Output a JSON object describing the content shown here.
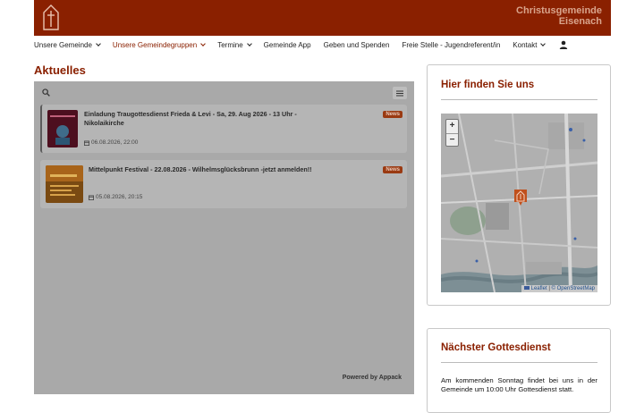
{
  "header": {
    "org_line1": "Christusgemeinde",
    "org_line2": "Eisenach",
    "colors": {
      "brand": "#8a2000",
      "brand_text": "#d9a48c"
    }
  },
  "nav": {
    "items": [
      {
        "label": "Unsere Gemeinde",
        "dropdown": true
      },
      {
        "label": "Unsere Gemeindegruppen",
        "dropdown": true,
        "active": true
      },
      {
        "label": "Termine",
        "dropdown": true
      },
      {
        "label": "Gemeinde App"
      },
      {
        "label": "Geben und Spenden"
      },
      {
        "label": "Freie Stelle - Jugendreferent/in"
      },
      {
        "label": "Kontakt",
        "dropdown": true
      }
    ],
    "user_icon": "user-icon"
  },
  "news": {
    "heading": "Aktuelles",
    "items": [
      {
        "title": "Einladung Traugottesdienst Frieda & Levi - Sa, 29. Aug 2026 - 13 Uhr - Nikolaikirche",
        "date": "06.08.2026, 22:00",
        "badge": "News"
      },
      {
        "title": "Mittelpunkt Festival - 22.08.2026 - Wilhelmsglücksbrunn -jetzt anmelden!!",
        "date": "05.08.2026, 20:15",
        "badge": "News"
      }
    ],
    "powered_by": "Powered by Appack"
  },
  "location_card": {
    "title": "Hier finden Sie uns",
    "zoom_in": "+",
    "zoom_out": "−",
    "attribution_leaflet": "Leaflet",
    "attribution_sep": "|",
    "attribution_osm": "© OpenStreetMap"
  },
  "service_card": {
    "title": "Nächster Gottesdienst",
    "text": "Am kommenden Sonntag findet bei uns in der Gemeinde um 10:00 Uhr Gottesdienst statt."
  }
}
